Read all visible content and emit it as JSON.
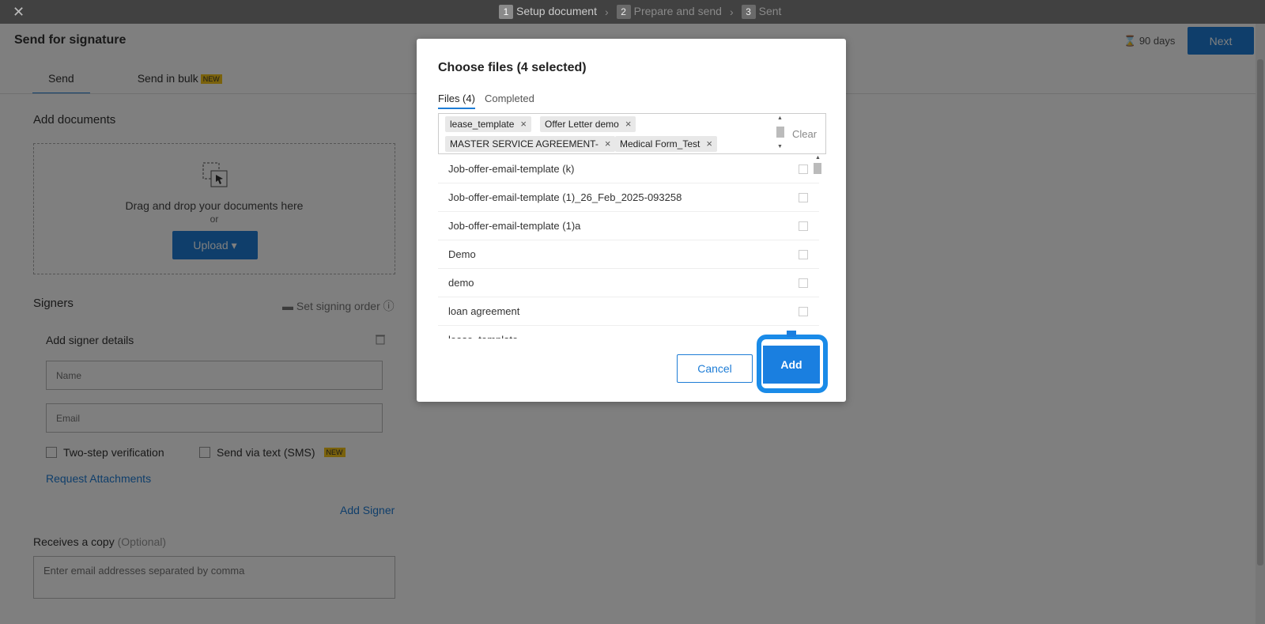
{
  "topbar": {
    "steps": [
      {
        "num": "1",
        "label": "Setup document"
      },
      {
        "num": "2",
        "label": "Prepare and send"
      },
      {
        "num": "3",
        "label": "Sent"
      }
    ]
  },
  "header": {
    "title": "Send for signature",
    "days": "90 days",
    "next_label": "Next"
  },
  "tabs": {
    "send": "Send",
    "send_bulk": "Send in bulk",
    "new_badge": "NEW"
  },
  "documents": {
    "title": "Add documents",
    "drop_text": "Drag and drop your documents here",
    "or_text": "or",
    "upload_label": "Upload ▾"
  },
  "signers": {
    "title": "Signers",
    "set_order": "Set signing order",
    "add_details": "Add signer details",
    "name_placeholder": "Name",
    "email_placeholder": "Email",
    "two_step": "Two-step verification",
    "sms": "Send via text (SMS)",
    "request_attachments": "Request Attachments",
    "add_signer": "Add Signer"
  },
  "copy": {
    "title": "Receives a copy",
    "optional": "(Optional)",
    "placeholder": "Enter email addresses separated by comma"
  },
  "modal": {
    "title": "Choose files (4 selected)",
    "tab_files": "Files (4)",
    "tab_completed": "Completed",
    "chips": [
      "lease_template",
      "Offer Letter demo",
      "MASTER SERVICE AGREEMENT-",
      "Medical Form_Test"
    ],
    "clear_label": "Clear",
    "files": [
      "Job-offer-email-template (k)",
      "Job-offer-email-template (1)_26_Feb_2025-093258",
      "Job-offer-email-template (1)a",
      "Demo",
      "demo",
      "loan agreement",
      "lease_template"
    ],
    "cancel_label": "Cancel",
    "add_label": "Add"
  }
}
